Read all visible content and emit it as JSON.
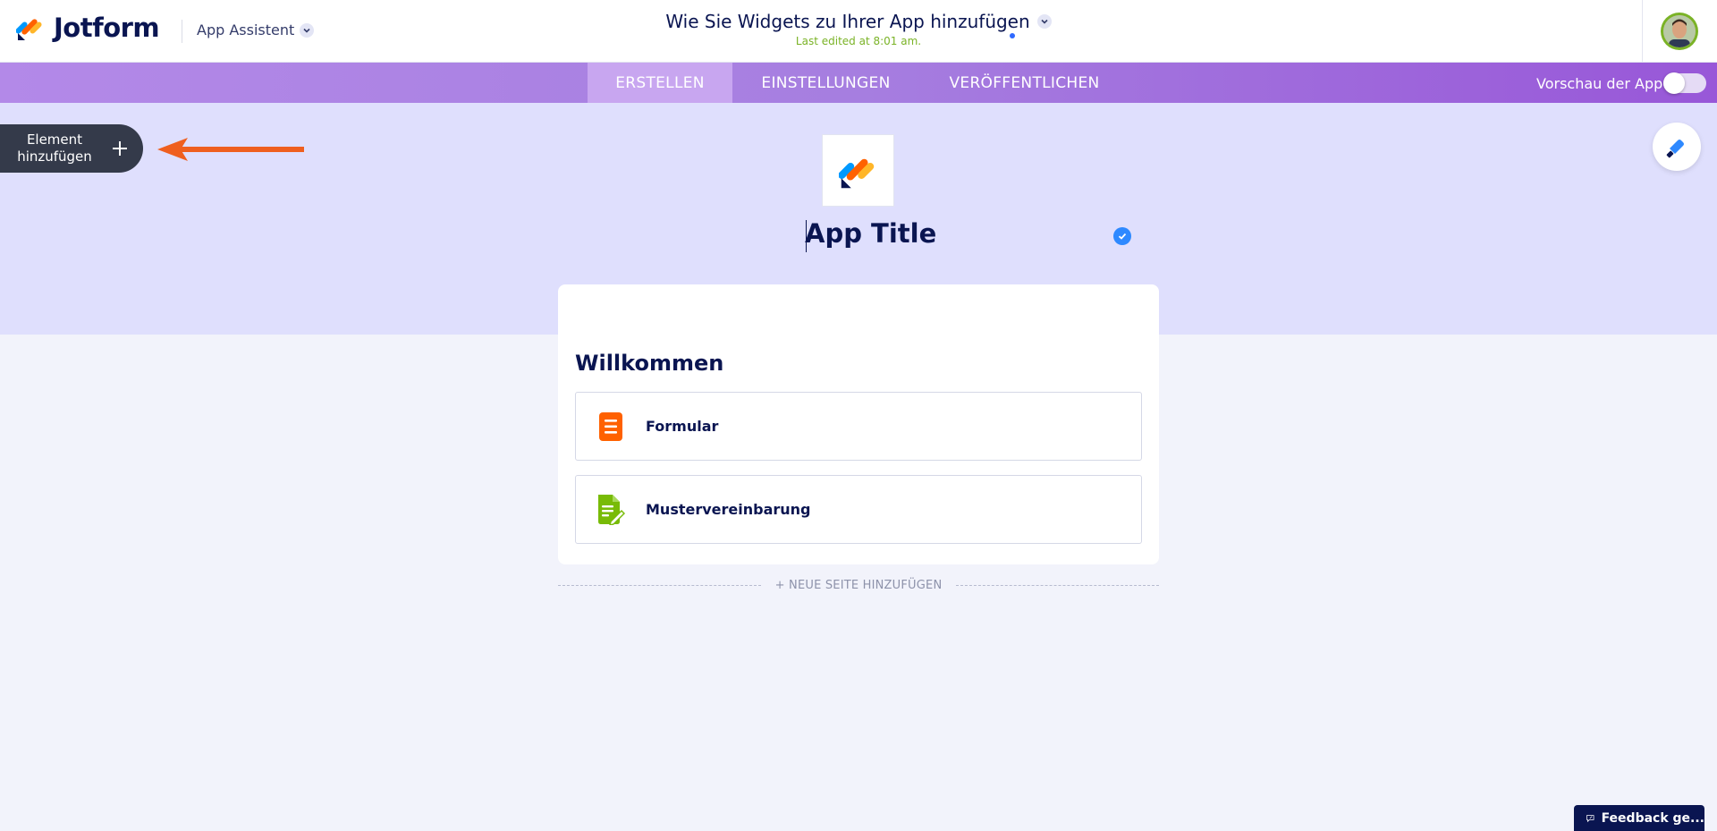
{
  "header": {
    "brand": "Jotform",
    "app_assistant": "App Assistent",
    "doc_title": "Wie Sie Widgets zu Ihrer App hinzufügen",
    "last_edited": "Last edited at 8:01 am."
  },
  "nav": {
    "tabs": [
      {
        "label": "ERSTELLEN",
        "active": true
      },
      {
        "label": "EINSTELLUNGEN",
        "active": false
      },
      {
        "label": "VERÖFFENTLICHEN",
        "active": false
      }
    ],
    "preview_label": "Vorschau der App",
    "preview_on": false
  },
  "builder": {
    "add_element_line1": "Element",
    "add_element_line2": "hinzufügen",
    "app_title": "App Title",
    "card_heading": "Willkommen",
    "items": [
      {
        "label": "Formular",
        "icon": "form-icon",
        "color": "#ff6100"
      },
      {
        "label": "Mustervereinbarung",
        "icon": "sign-document-icon",
        "color": "#78bb07"
      }
    ],
    "add_page": "+ NEUE SEITE HINZUFÜGEN"
  },
  "feedback": {
    "label": "Feedback ge..."
  },
  "colors": {
    "navy": "#0a1551",
    "purple": "#9857d8",
    "hero_bg": "#dfdffd",
    "arrow": "#ef5f1f"
  }
}
